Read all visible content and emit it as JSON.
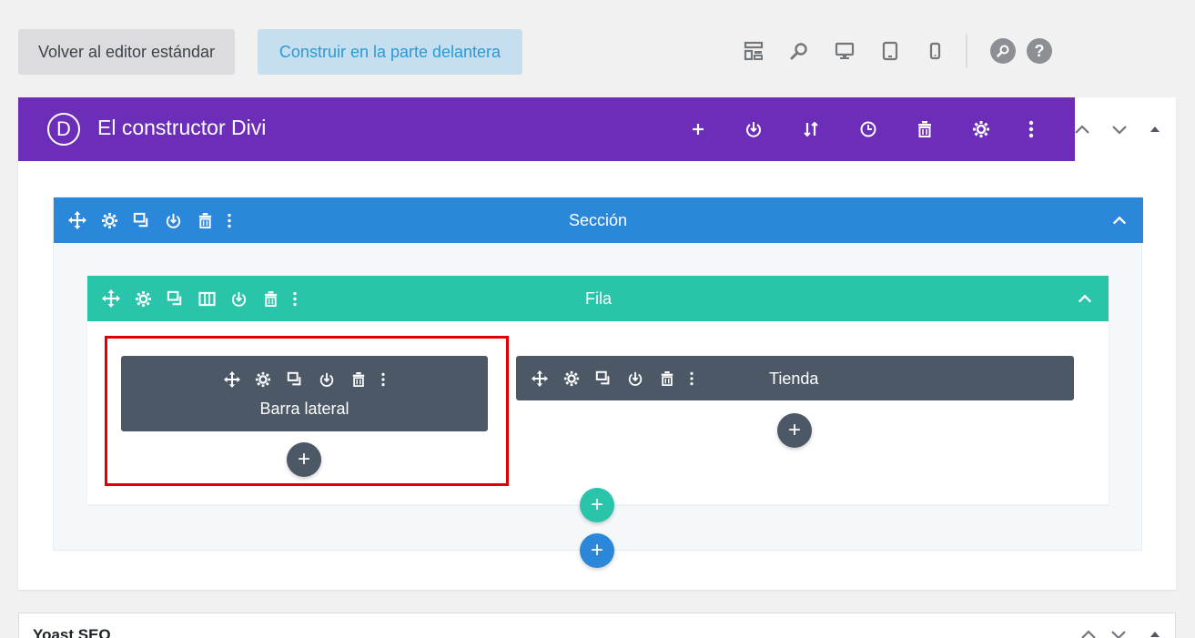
{
  "toolbar": {
    "standard_editor_label": "Volver al editor estándar",
    "front_builder_label": "Construir en la parte delantera"
  },
  "builder": {
    "title": "El constructor Divi",
    "logo_letter": "D"
  },
  "section": {
    "title": "Sección"
  },
  "row": {
    "title": "Fila"
  },
  "modules": {
    "sidebar_title": "Barra lateral",
    "shop_title": "Tienda"
  },
  "add_symbol": "+",
  "yoast": {
    "title": "Yoast SEO"
  },
  "colors": {
    "purple": "#6c2eb9",
    "section_blue": "#2b87da",
    "row_teal": "#29c4a9",
    "module_gray": "#4c5866",
    "highlight_red": "#e10000"
  }
}
